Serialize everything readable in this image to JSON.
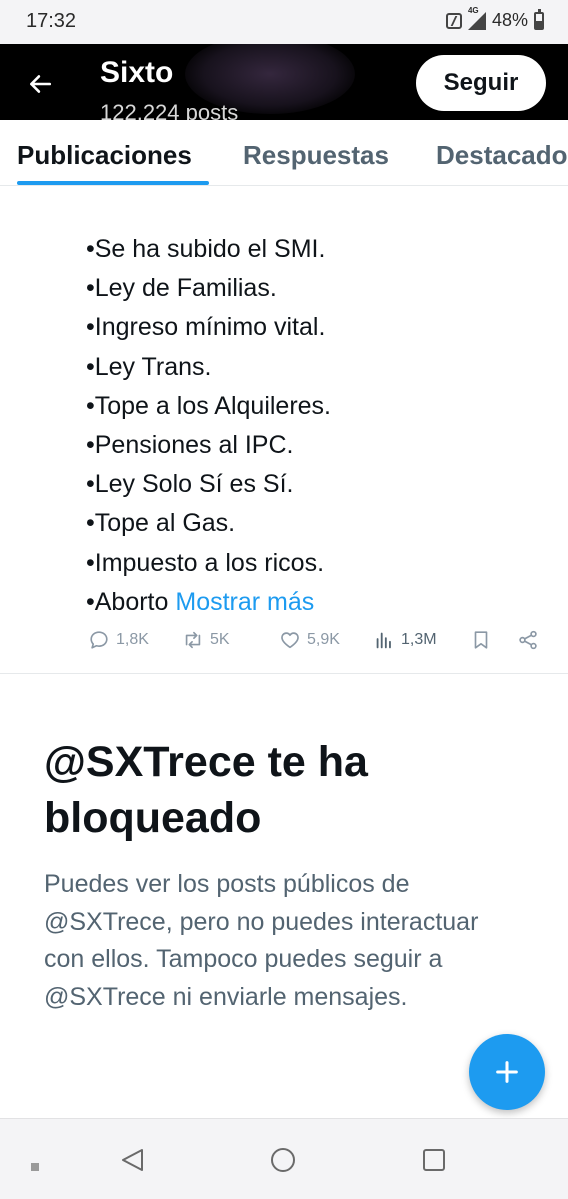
{
  "status_bar": {
    "time": "17:32",
    "network": "4G",
    "battery": "48%"
  },
  "profile": {
    "name": "Sixto",
    "posts_count": "122.224 posts",
    "follow_label": "Seguir"
  },
  "tabs": [
    {
      "label": "Publicaciones",
      "active": true
    },
    {
      "label": "Respuestas",
      "active": false
    },
    {
      "label": "Destacados",
      "active": false
    }
  ],
  "post": {
    "lines": [
      "•Se ha subido el SMI.",
      "•Ley de Familias.",
      "•Ingreso mínimo vital.",
      "•Ley Trans.",
      "•Tope a los Alquileres.",
      "•Pensiones al IPC.",
      "•Ley Solo Sí es Sí.",
      "•Tope al Gas.",
      "•Impuesto a los ricos.",
      "•Aborto"
    ],
    "show_more": "Mostrar más",
    "metrics": {
      "replies": "1,8K",
      "reposts": "5K",
      "likes": "5,9K",
      "views": "1,3M"
    }
  },
  "blocked": {
    "title": "@SXTrece te ha bloqueado",
    "description": "Puedes ver los posts públicos de @SXTrece, pero no puedes interactuar con ellos. Tampoco puedes seguir a @SXTrece ni enviarle mensajes."
  },
  "colors": {
    "accent": "#1d9bf0",
    "header_bg": "#000000",
    "muted_text": "#536471"
  }
}
